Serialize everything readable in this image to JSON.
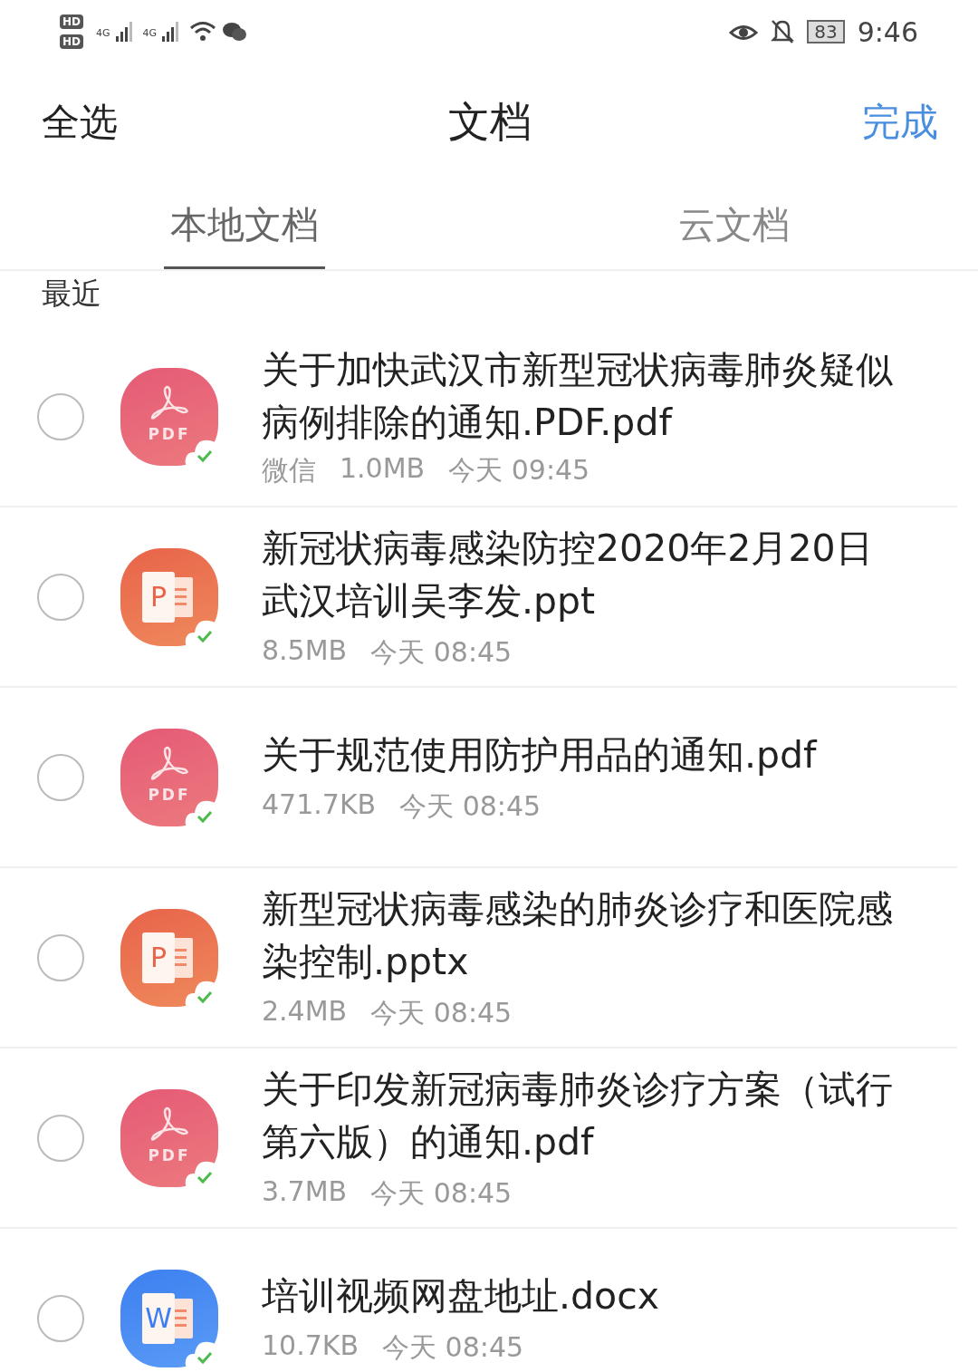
{
  "status_bar": {
    "sim_labels": [
      "HD",
      "HD"
    ],
    "network_labels": [
      "4G",
      "4G"
    ],
    "battery": "83",
    "time": "9:46"
  },
  "header": {
    "select_all": "全选",
    "title": "文档",
    "done": "完成"
  },
  "tabs": [
    {
      "label": "本地文档",
      "selected": true
    },
    {
      "label": "云文档",
      "selected": false
    }
  ],
  "section": "最近",
  "files": [
    {
      "kind": "pdf",
      "icon_label": "PDF",
      "name": "关于加快武汉市新型冠状病毒肺炎疑似病例排除的通知.PDF.pdf",
      "meta": [
        "微信",
        "1.0MB",
        "今天 09:45"
      ],
      "checked": false
    },
    {
      "kind": "ppt",
      "icon_label": "P",
      "name": "新冠状病毒感染防控2020年2月20日武汉培训吴李发.ppt",
      "meta": [
        "8.5MB",
        "今天 08:45"
      ],
      "checked": false
    },
    {
      "kind": "pdf",
      "icon_label": "PDF",
      "name": "关于规范使用防护用品的通知.pdf",
      "meta": [
        "471.7KB",
        "今天 08:45"
      ],
      "checked": false
    },
    {
      "kind": "ppt",
      "icon_label": "P",
      "name": "新型冠状病毒感染的肺炎诊疗和医院感染控制.pptx",
      "meta": [
        "2.4MB",
        "今天 08:45"
      ],
      "checked": false
    },
    {
      "kind": "pdf",
      "icon_label": "PDF",
      "name": "关于印发新冠病毒肺炎诊疗方案（试行第六版）的通知.pdf",
      "meta": [
        "3.7MB",
        "今天 08:45"
      ],
      "checked": false
    },
    {
      "kind": "doc",
      "icon_label": "W",
      "name": "培训视频网盘地址.docx",
      "meta": [
        "10.7KB",
        "今天 08:45"
      ],
      "checked": false
    }
  ]
}
